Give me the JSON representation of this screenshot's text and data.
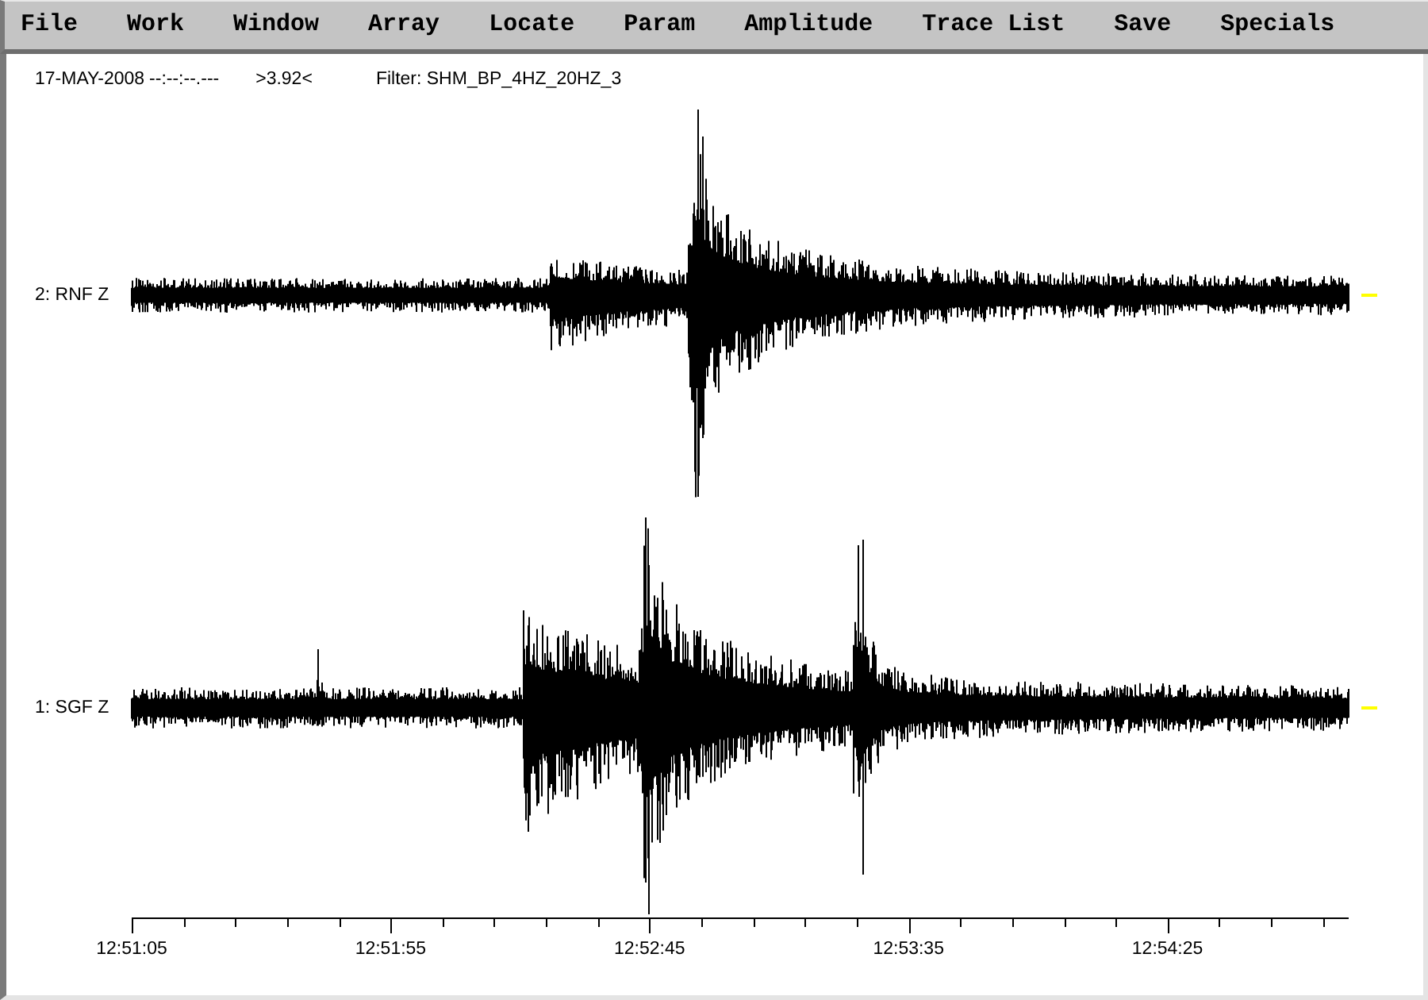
{
  "menu_bar": {
    "items": [
      "File",
      "Work",
      "Window",
      "Array",
      "Locate",
      "Param",
      "Amplitude",
      "Trace List",
      "Save",
      "Specials"
    ]
  },
  "header": {
    "date": "17-MAY-2008",
    "time": "--:--:--.---",
    "reading": ">3.92<",
    "filter": "Filter: SHM_BP_4HZ_20HZ_3"
  },
  "traces": [
    {
      "label": "2: RNF Z"
    },
    {
      "label": "1: SGF Z"
    }
  ],
  "time_axis": {
    "labels": [
      "12:51:05",
      "12:51:55",
      "12:52:45",
      "12:53:35",
      "12:54:25"
    ]
  }
}
